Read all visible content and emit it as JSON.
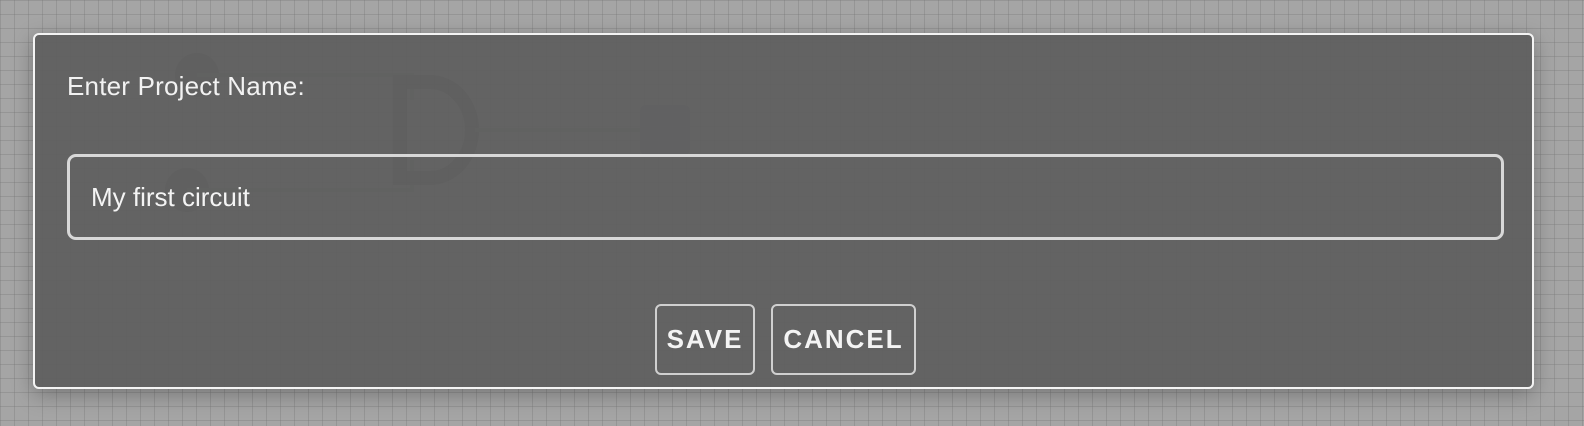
{
  "dialog": {
    "label": "Enter Project Name:",
    "input_value": "My first circuit",
    "save_label": "SAVE",
    "cancel_label": "CANCEL"
  },
  "colors": {
    "dialog_bg": "#606060",
    "dialog_border": "#f4f4f4",
    "text": "#f2f2f2",
    "canvas_bg": "#a5a5a5"
  }
}
